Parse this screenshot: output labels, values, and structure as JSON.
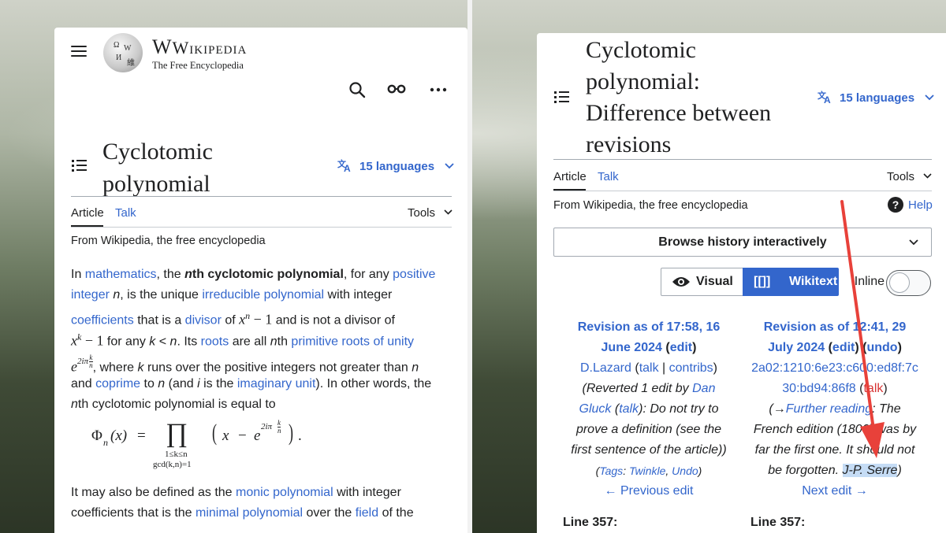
{
  "left": {
    "wordmark": "Wikipedia",
    "tagline": "The Free Encyclopedia",
    "title_line1": "Cyclotomic",
    "title_line2": "polynomial",
    "languages": "15 languages",
    "tab_article": "Article",
    "tab_talk": "Talk",
    "tools": "Tools",
    "from": "From Wikipedia, the free encyclopedia",
    "l1": {
      "a": "In ",
      "b": "mathematics",
      ", the ": "",
      "c": ", the ",
      "d": "n",
      "e": "th cyclotomic polynomial",
      "f": ", for any ",
      "g": "positive"
    },
    "l2": {
      "a": "integer",
      "b": " ",
      "c": "n",
      "d": ", is the unique ",
      "e": "irreducible polynomial",
      "f": " with integer"
    },
    "l3": {
      "a": "coefficients",
      "b": " that is a ",
      "c": "divisor",
      "d": " of ",
      "e": "x",
      "f": "n",
      "g": " − 1",
      "h": " and is not a divisor of"
    },
    "l4": {
      "a": "x",
      "b": "k",
      "c": " − 1",
      "d": " for any ",
      "e": "k",
      "f": " < ",
      "g": "n",
      "h": ". Its ",
      "i": "roots",
      "j": " are all ",
      "k": "n",
      "l": "th ",
      "m": "primitive roots of unity"
    },
    "l5": {
      "a": "e",
      "b": "2iπ",
      "bk": "k",
      "bn": "n",
      "c": ", where ",
      "d": "k",
      "e": " runs over the positive integers not greater than ",
      "f": "n"
    },
    "l6": {
      "a": "and ",
      "b": "coprime",
      "c": " to ",
      "d": "n",
      "e": " (and ",
      "f": "i",
      "g": " is the ",
      "h": "imaginary unit",
      "i": "). In other words, the"
    },
    "l7": {
      "a": "n",
      "b": "th cyclotomic polynomial is equal to"
    },
    "formula": {
      "lhs": "Φ",
      "sub": "n",
      "x": "(x)",
      "eq": "=",
      "prod": "∏",
      "r1": "1≤k≤n",
      "r2": "gcd(k,n)=1",
      "open": "(",
      "x2": "x",
      "minus": "−",
      "e": "e",
      "exp": "2iπ",
      "ek": "k",
      "en": "n",
      "close": ")",
      "dot": "."
    },
    "l8": {
      "a": "It may also be defined as the ",
      "b": "monic polynomial",
      "c": " with integer"
    },
    "l9": {
      "a": "coefficients that is the ",
      "b": "minimal polynomial",
      "c": " over the ",
      "d": "field",
      "e": " of the"
    }
  },
  "right": {
    "title_line1": "Cyclotomic",
    "title_line2": "polynomial:",
    "title_line3": "Difference between",
    "title_line4": "revisions",
    "languages": "15 languages",
    "tab_article": "Article",
    "tab_talk": "Talk",
    "tools": "Tools",
    "from": "From Wikipedia, the free encyclopedia",
    "help": "Help",
    "browse": "Browse history interactively",
    "visual": "Visual",
    "wikitext_icon": "[[]]",
    "wikitext": "Wikitext",
    "inline": "Inline",
    "old": {
      "r1": "Revision as of 17:58, 16",
      "r2a": "June 2024",
      "r2b": " (",
      "r2c": "edit",
      "r2d": ")",
      "u_a": "D.Lazard",
      "u_b": " (",
      "u_c": "talk",
      "u_d": " | ",
      "u_e": "contribs",
      "u_f": ")",
      "s1a": "(Reverted 1 edit by ",
      "s1b": "Dan",
      "s2a": "Gluck",
      "s2b": " (",
      "s2c": "talk",
      "s2d": "): Do not try to",
      "s3": "prove a definition (see the",
      "s4": "first sentence of the article))",
      "t_a": "(",
      "t_b": "Tags",
      "t_c": ": ",
      "t_d": "Twinkle",
      "t_e": ", ",
      "t_f": "Undo",
      "t_g": ")",
      "prev": "← Previous edit",
      "line": "Line 357:"
    },
    "new": {
      "r1": "Revision as of 12:41, 29",
      "r2a": "July 2024",
      "r2b": " (",
      "r2c": "edit",
      "r2d": ") (",
      "r2e": "undo",
      "r2f": ")",
      "u1": "2a02:1210:6e23:c600:ed8f:7c",
      "u2": "30:bd94:86f8",
      "u2b": " (",
      "u2c": "talk",
      "u2d": ")",
      "s1a": "(→",
      "s1b": "Further reading",
      "s1c": ": The",
      "s2": "French edition (1800) was by",
      "s3": "far the first one. It should not",
      "s4a": "be forgotten. ",
      "s4b": "J-P. Serre",
      "s4c": ")",
      "next": "Next edit →",
      "line": "Line 357:"
    }
  }
}
